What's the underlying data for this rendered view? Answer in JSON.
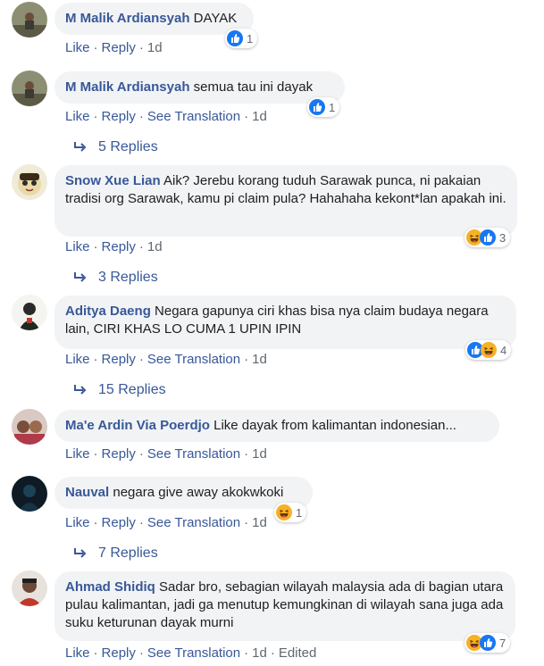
{
  "actions": {
    "like": "Like",
    "reply": "Reply",
    "see_translation": "See Translation",
    "dot": "·"
  },
  "colors": {
    "link": "#385898",
    "bubble": "#f2f3f5",
    "like_blue": "#1877f2",
    "haha_yellow": "#f7b125"
  },
  "comments": [
    {
      "author": "M Malik Ardiansyah",
      "text": "DAYAK",
      "time": "1d",
      "reaction_count": "1",
      "reactions": [
        "like-icon"
      ],
      "replies": ""
    },
    {
      "author": "M Malik Ardiansyah",
      "text": "semua tau ini dayak",
      "time": "1d",
      "reaction_count": "1",
      "reactions": [
        "like-icon"
      ],
      "replies": "5 Replies"
    },
    {
      "author": "Snow Xue Lian",
      "text": "Aik? Jerebu korang tuduh Sarawak punca, ni pakaian tradisi org Sarawak, kamu pi claim pula? Hahahaha kekont*lan apakah ini.",
      "time": "1d",
      "reaction_count": "3",
      "reactions": [
        "haha-icon",
        "like-icon"
      ],
      "replies": "3 Replies"
    },
    {
      "author": "Aditya Daeng",
      "text": "Negara gapunya ciri khas bisa nya claim budaya negara lain, CIRI KHAS LO CUMA 1 UPIN IPIN",
      "time": "1d",
      "reaction_count": "4",
      "reactions": [
        "like-icon",
        "haha-icon"
      ],
      "replies": "15 Replies"
    },
    {
      "author": "Ma'e Ardin Via Poerdjo",
      "text": "Like dayak from kalimantan indonesian...",
      "time": "1d",
      "reaction_count": "",
      "reactions": [],
      "replies": ""
    },
    {
      "author": "Nauval",
      "text": "negara give away akokwkoki",
      "time": "1d",
      "reaction_count": "1",
      "reactions": [
        "haha-icon"
      ],
      "replies": "7 Replies"
    },
    {
      "author": "Ahmad Shidiq",
      "text": "Sadar bro, sebagian wilayah malaysia ada di bagian utara pulau kalimantan, jadi ga menutup kemungkinan di wilayah sana juga ada suku keturunan dayak murni",
      "time": "1d",
      "edited": "Edited",
      "reaction_count": "7",
      "reactions": [
        "haha-icon",
        "like-icon"
      ],
      "replies": ""
    }
  ]
}
